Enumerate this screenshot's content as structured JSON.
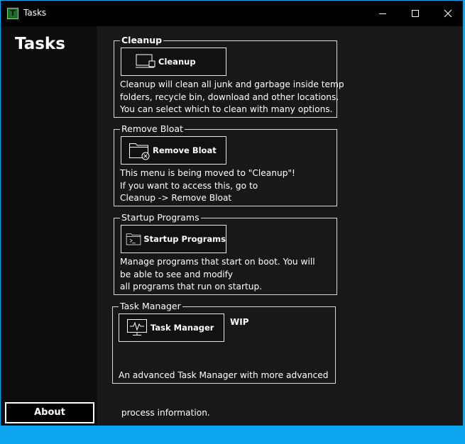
{
  "window": {
    "title": "Tasks",
    "app_icon_glyph": "T",
    "accent_color": "#0ea5f0",
    "controls": [
      "minimize-icon",
      "maximize-icon",
      "close-icon"
    ]
  },
  "sidebar": {
    "title": "Tasks",
    "about_label": "About"
  },
  "groups": [
    {
      "label": "Cleanup",
      "button_label": "Cleanup",
      "icon": "cleanup-icon",
      "description": [
        "Cleanup will clean all junk and garbage inside temp",
        "folders, recycle bin, download and other locations.",
        "You can select which to clean with many options."
      ]
    },
    {
      "label": "Remove Bloat",
      "button_label": "Remove Bloat",
      "icon": "folder-remove-icon",
      "description": [
        "This menu is being moved to \"Cleanup\"!",
        "If you want to access this, go to",
        "Cleanup -> Remove Bloat"
      ]
    },
    {
      "label": "Startup Programs",
      "button_label": "Startup Programs",
      "icon": "folder-terminal-icon",
      "description": [
        "Manage programs that start on boot. You will",
        "be able to see and modify",
        "all programs that run on startup."
      ]
    },
    {
      "label": "Task Manager",
      "button_label": "Task Manager",
      "icon": "monitor-activity-icon",
      "status": "WIP",
      "description": [
        "An advanced Task Manager with more advanced",
        " process information."
      ]
    }
  ]
}
